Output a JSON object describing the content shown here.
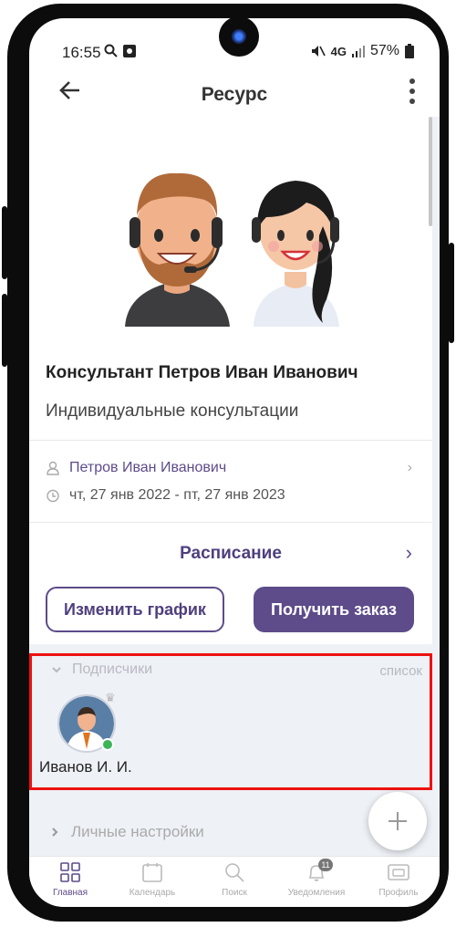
{
  "status_bar": {
    "time": "16:55",
    "network": "4G",
    "battery": "57%"
  },
  "app_bar": {
    "title": "Ресурс",
    "back_icon": "arrow-left-icon",
    "menu_icon": "more-vertical-icon"
  },
  "resource": {
    "title": "Консультант Петров Иван Иванович",
    "subtitle": "Индивидуальные консультации",
    "owner": "Петров Иван Иванович",
    "date_range": "чт, 27 янв 2022 - пт, 27 янв 2023"
  },
  "schedule": {
    "label": "Расписание"
  },
  "actions": {
    "change_schedule": "Изменить график",
    "get_order": "Получить заказ"
  },
  "subscribers": {
    "header": "Подписчики",
    "list_link": "список",
    "items": [
      {
        "name": "Иванов И. И.",
        "online": true
      }
    ]
  },
  "personal_settings": {
    "header": "Личные настройки"
  },
  "bottom_nav": {
    "items": [
      {
        "label": "Главная",
        "icon": "grid-icon",
        "active": true
      },
      {
        "label": "Календарь",
        "icon": "calendar-icon"
      },
      {
        "label": "Поиск",
        "icon": "search-icon"
      },
      {
        "label": "Уведомления",
        "icon": "bell-icon",
        "badge": "11"
      },
      {
        "label": "Профиль",
        "icon": "profile-card-icon"
      }
    ]
  },
  "colors": {
    "accent": "#5d4b8a",
    "highlight_border": "#ee1111",
    "section_bg": "#eef1f6"
  }
}
